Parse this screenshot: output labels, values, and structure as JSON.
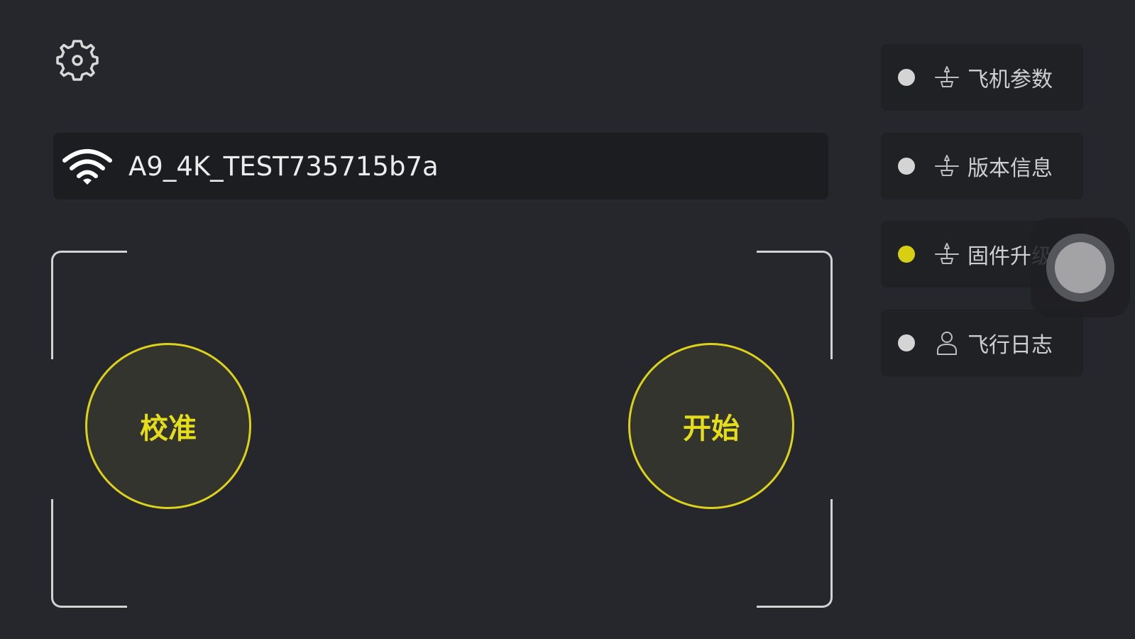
{
  "settings": {
    "icon": "gear-icon"
  },
  "wifi": {
    "icon": "wifi-icon",
    "ssid": "A9_4K_TEST735715b7a"
  },
  "controls": {
    "calibrate_label": "校准",
    "start_label": "开始"
  },
  "menu": {
    "items": [
      {
        "label": "飞机参数",
        "icon": "drone-icon",
        "active": false
      },
      {
        "label": "版本信息",
        "icon": "drone-icon",
        "active": false
      },
      {
        "label": "固件升级",
        "icon": "drone-icon",
        "active": true
      },
      {
        "label": "飞行日志",
        "icon": "user-icon",
        "active": false
      }
    ]
  },
  "colors": {
    "background": "#26272d",
    "accent": "#dcd21a",
    "panel": "#1c1d21",
    "menu_panel": "#202125",
    "inactive_dot": "#d4d4d4"
  },
  "floating_button": {
    "icon": "assistive-touch-icon"
  }
}
